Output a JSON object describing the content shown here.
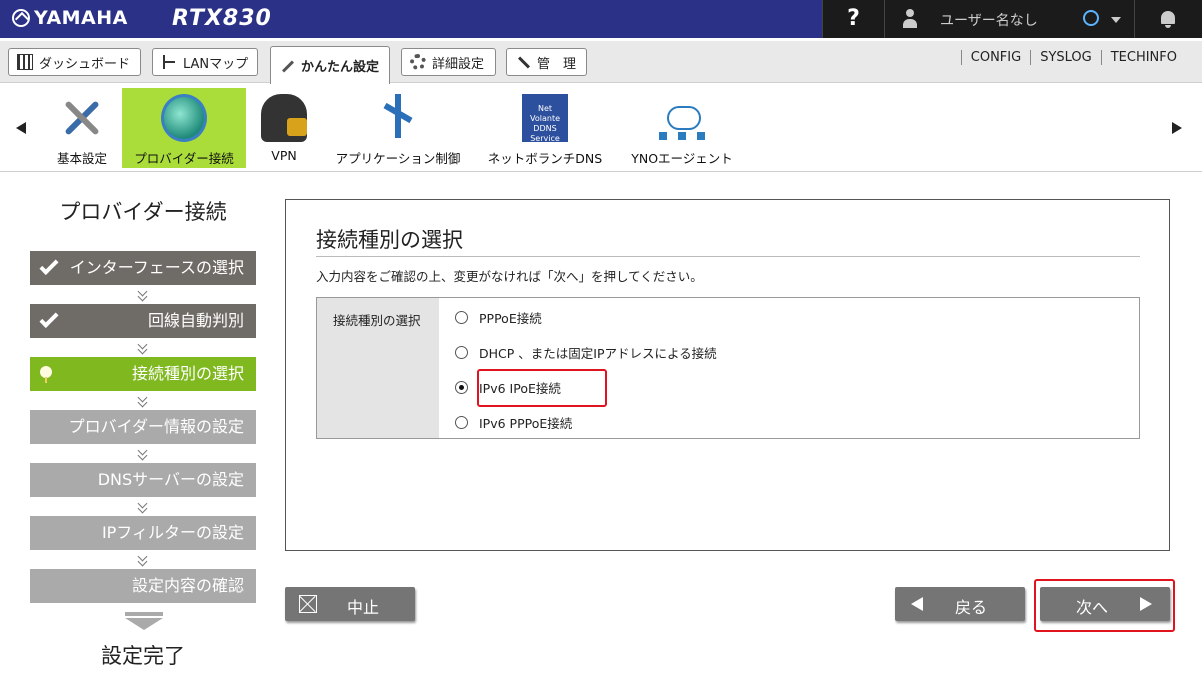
{
  "header": {
    "brand": "YAMAHA",
    "model": "RTX830",
    "help": "?",
    "user": "ユーザー名なし"
  },
  "menu": {
    "tabs": [
      {
        "label": "ダッシュボード"
      },
      {
        "label": "LANマップ"
      },
      {
        "label": "かんたん設定"
      },
      {
        "label": "詳細設定"
      },
      {
        "label": "管　理"
      }
    ],
    "links": [
      "CONFIG",
      "SYSLOG",
      "TECHINFO"
    ]
  },
  "features": [
    {
      "label": "基本設定"
    },
    {
      "label": "プロバイダー接続"
    },
    {
      "label": "VPN"
    },
    {
      "label": "アプリケーション制御"
    },
    {
      "label": "ネットボランチDNS"
    },
    {
      "label": "YNOエージェント"
    }
  ],
  "dns_icon_text": "Net Volante DDNS Service",
  "wizard": {
    "title": "プロバイダー接続",
    "steps": [
      {
        "label": "インターフェースの選択",
        "state": "done"
      },
      {
        "label": "回線自動判別",
        "state": "done"
      },
      {
        "label": "接続種別の選択",
        "state": "current"
      },
      {
        "label": "プロバイダー情報の設定",
        "state": "todo"
      },
      {
        "label": "DNSサーバーの設定",
        "state": "todo"
      },
      {
        "label": "IPフィルターの設定",
        "state": "todo"
      },
      {
        "label": "設定内容の確認",
        "state": "todo"
      }
    ],
    "final": "設定完了"
  },
  "panel": {
    "title": "接続種別の選択",
    "description": "入力内容をご確認の上、変更がなければ「次へ」を押してください。",
    "field_label": "接続種別の選択",
    "options": [
      {
        "label": "PPPoE接続",
        "selected": false
      },
      {
        "label": "DHCP 、または固定IPアドレスによる接続",
        "selected": false
      },
      {
        "label": "IPv6 IPoE接続",
        "selected": true
      },
      {
        "label": "IPv6 PPPoE接続",
        "selected": false
      }
    ]
  },
  "buttons": {
    "cancel": "中止",
    "back": "戻る",
    "next": "次へ"
  },
  "colors": {
    "header_bg": "#2a3186",
    "accent_green": "#7fb81f",
    "highlight_red": "#e0141e"
  }
}
